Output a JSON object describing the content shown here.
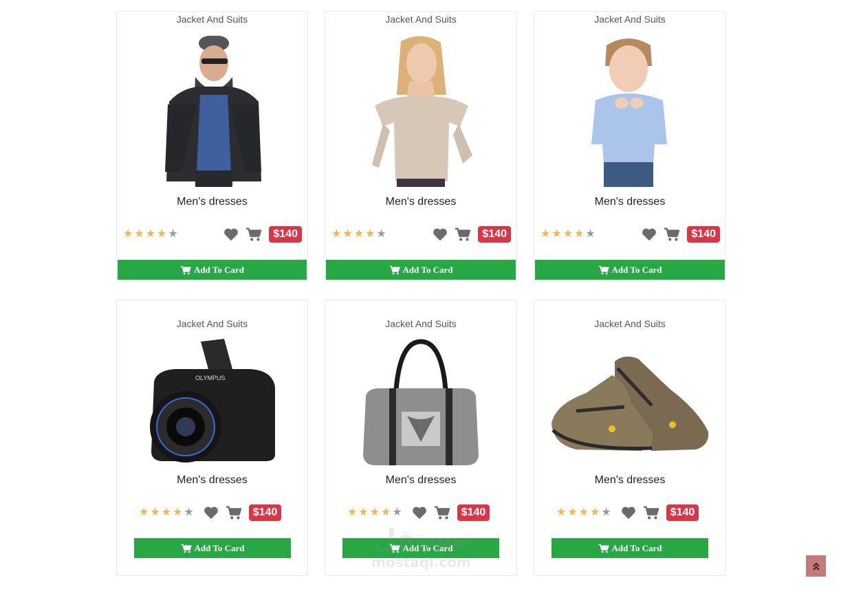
{
  "products": [
    {
      "category": "Jacket And Suits",
      "title": "Men's dresses",
      "rating": 4,
      "max_rating": 5,
      "price": "$140",
      "button_label": "Add To Card",
      "image": "man-in-leather-jacket"
    },
    {
      "category": "Jacket And Suits",
      "title": "Men's dresses",
      "rating": 4,
      "max_rating": 5,
      "price": "$140",
      "button_label": "Add To Card",
      "image": "woman-in-sweater"
    },
    {
      "category": "Jacket And Suits",
      "title": "Men's dresses",
      "rating": 4,
      "max_rating": 5,
      "price": "$140",
      "button_label": "Add To Card",
      "image": "boy-in-blue-shirt"
    },
    {
      "category": "Jacket And Suits",
      "title": "Men's dresses",
      "rating": 4,
      "max_rating": 5,
      "price": "$140",
      "button_label": "Add To Card",
      "image": "camera"
    },
    {
      "category": "Jacket And Suits",
      "title": "Men's dresses",
      "rating": 4,
      "max_rating": 5,
      "price": "$140",
      "button_label": "Add To Card",
      "image": "handbag"
    },
    {
      "category": "Jacket And Suits",
      "title": "Men's dresses",
      "rating": 4,
      "max_rating": 5,
      "price": "$140",
      "button_label": "Add To Card",
      "image": "shoes"
    }
  ],
  "watermark": {
    "arabic": "مستقل",
    "latin": "mostaql.com"
  },
  "colors": {
    "star": "#f7b64b",
    "price_badge": "#dc3545",
    "button": "#28a745",
    "scroll_top": "#c47b7b"
  },
  "icons": {
    "wishlist": "heart-icon",
    "cart": "cart-icon",
    "scroll_top": "double-chevron-up-icon"
  }
}
